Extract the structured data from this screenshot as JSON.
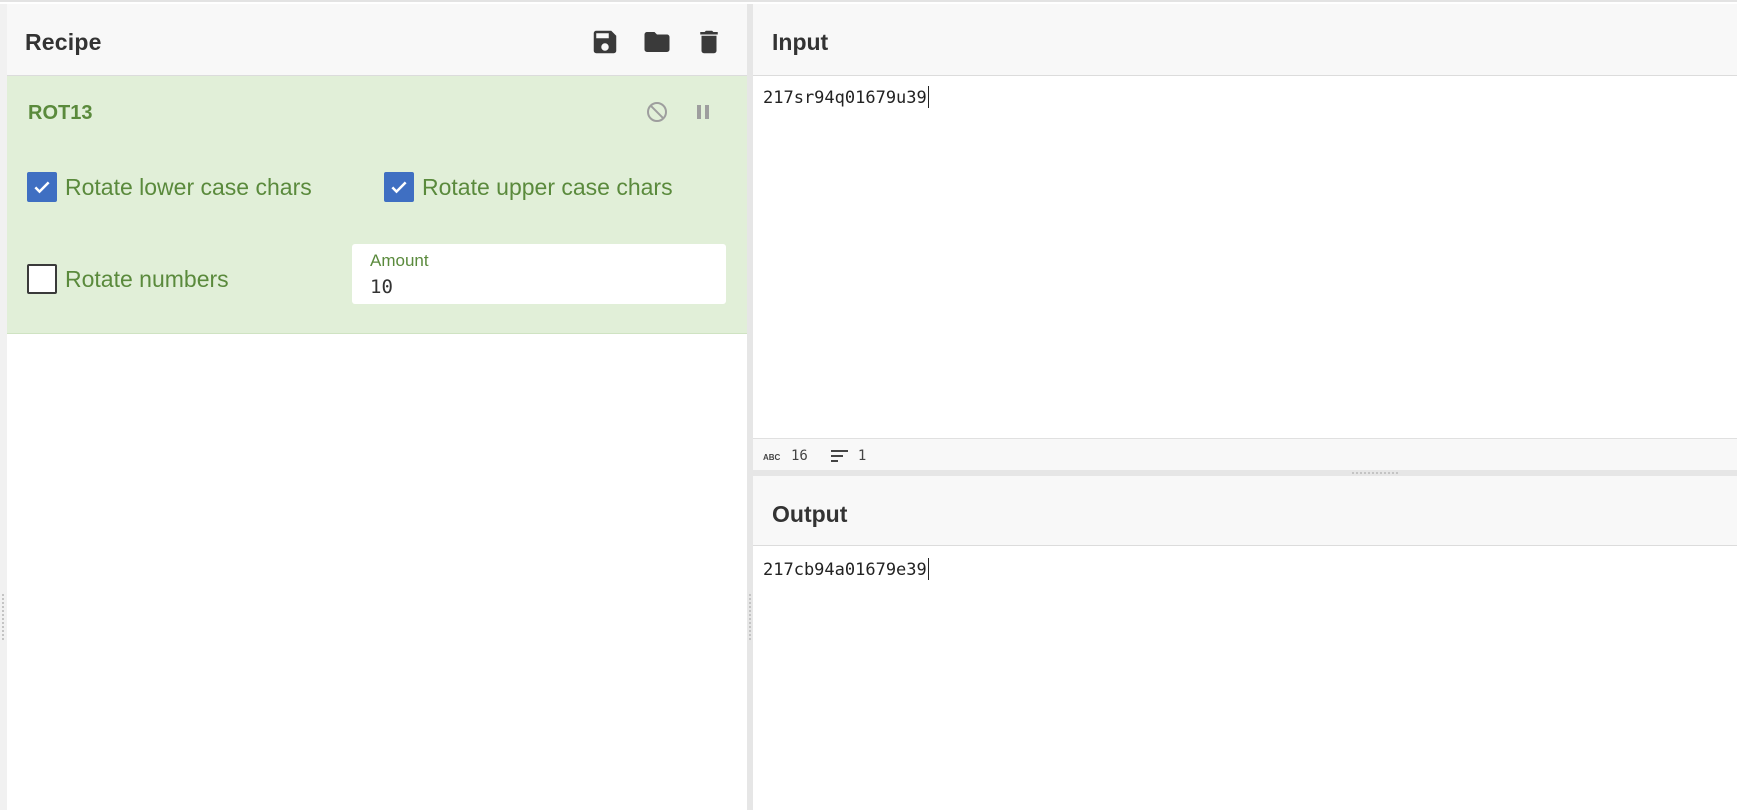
{
  "recipe": {
    "title": "Recipe",
    "icons": [
      "save-icon",
      "folder-icon",
      "trash-icon"
    ]
  },
  "operation": {
    "name": "ROT13",
    "controls": [
      "disable-icon",
      "pause-icon"
    ],
    "args": {
      "rotate_lower": {
        "label": "Rotate lower case chars",
        "checked": true
      },
      "rotate_upper": {
        "label": "Rotate upper case chars",
        "checked": true
      },
      "rotate_numbers": {
        "label": "Rotate numbers",
        "checked": false
      },
      "amount": {
        "label": "Amount",
        "value": "10"
      }
    }
  },
  "input": {
    "title": "Input",
    "text": "217sr94q01679u39",
    "stats": {
      "length": "16",
      "lines": "1"
    }
  },
  "output": {
    "title": "Output",
    "text": "217cb94a01679e39"
  },
  "colors": {
    "op_background": "#e1efd8",
    "op_accent": "#5a8a3c",
    "checkbox": "#3f6fc2"
  }
}
